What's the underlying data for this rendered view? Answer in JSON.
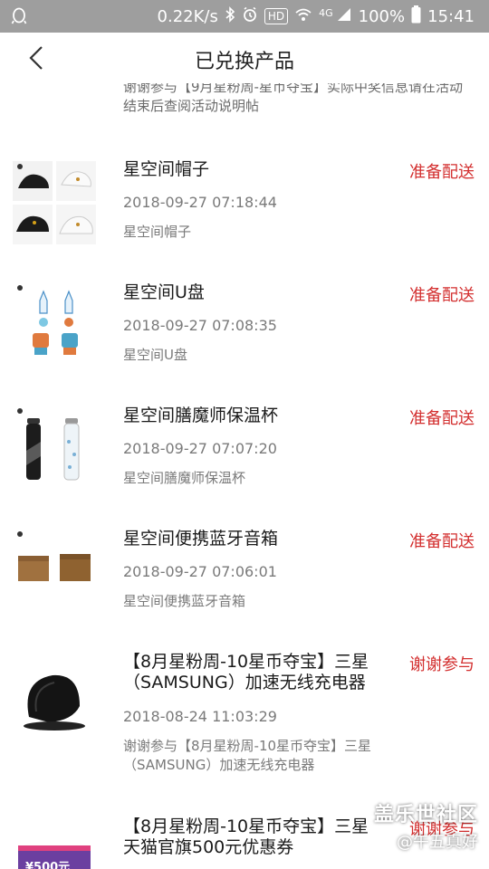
{
  "status_bar": {
    "speed": "0.22K/s",
    "hd": "HD",
    "network": "4G",
    "battery": "100%",
    "time": "15:41"
  },
  "header": {
    "title": "已兑换产品"
  },
  "partial_item": {
    "desc": "谢谢参与【9月星粉周-星币夺宝】实际中奖信息请在活动结束后查阅活动说明帖"
  },
  "items": [
    {
      "name": "星空间帽子",
      "status": "准备配送",
      "time": "2018-09-27 07:18:44",
      "desc": "星空间帽子"
    },
    {
      "name": "星空间U盘",
      "status": "准备配送",
      "time": "2018-09-27 07:08:35",
      "desc": "星空间U盘"
    },
    {
      "name": "星空间膳魔师保温杯",
      "status": "准备配送",
      "time": "2018-09-27 07:07:20",
      "desc": "星空间膳魔师保温杯"
    },
    {
      "name": "星空间便携蓝牙音箱",
      "status": "准备配送",
      "time": "2018-09-27 07:06:01",
      "desc": "星空间便携蓝牙音箱"
    },
    {
      "name": "【8月星粉周-10星币夺宝】三星（SAMSUNG）加速无线充电器",
      "status": "谢谢参与",
      "time": "2018-08-24 11:03:29",
      "desc": "谢谢参与【8月星粉周-10星币夺宝】三星（SAMSUNG）加速无线充电器"
    },
    {
      "name": "【8月星粉周-10星币夺宝】三星天猫官旗500元优惠券",
      "status": "谢谢参与",
      "time": "",
      "desc": "",
      "coupon_label": "¥500元"
    }
  ],
  "watermark": {
    "line1": "盖乐世社区",
    "line2": "@午五真好"
  },
  "colors": {
    "status_bar": "#9e9e9e",
    "status_red": "#d32f2f",
    "secondary_text": "#7a7a7a"
  }
}
